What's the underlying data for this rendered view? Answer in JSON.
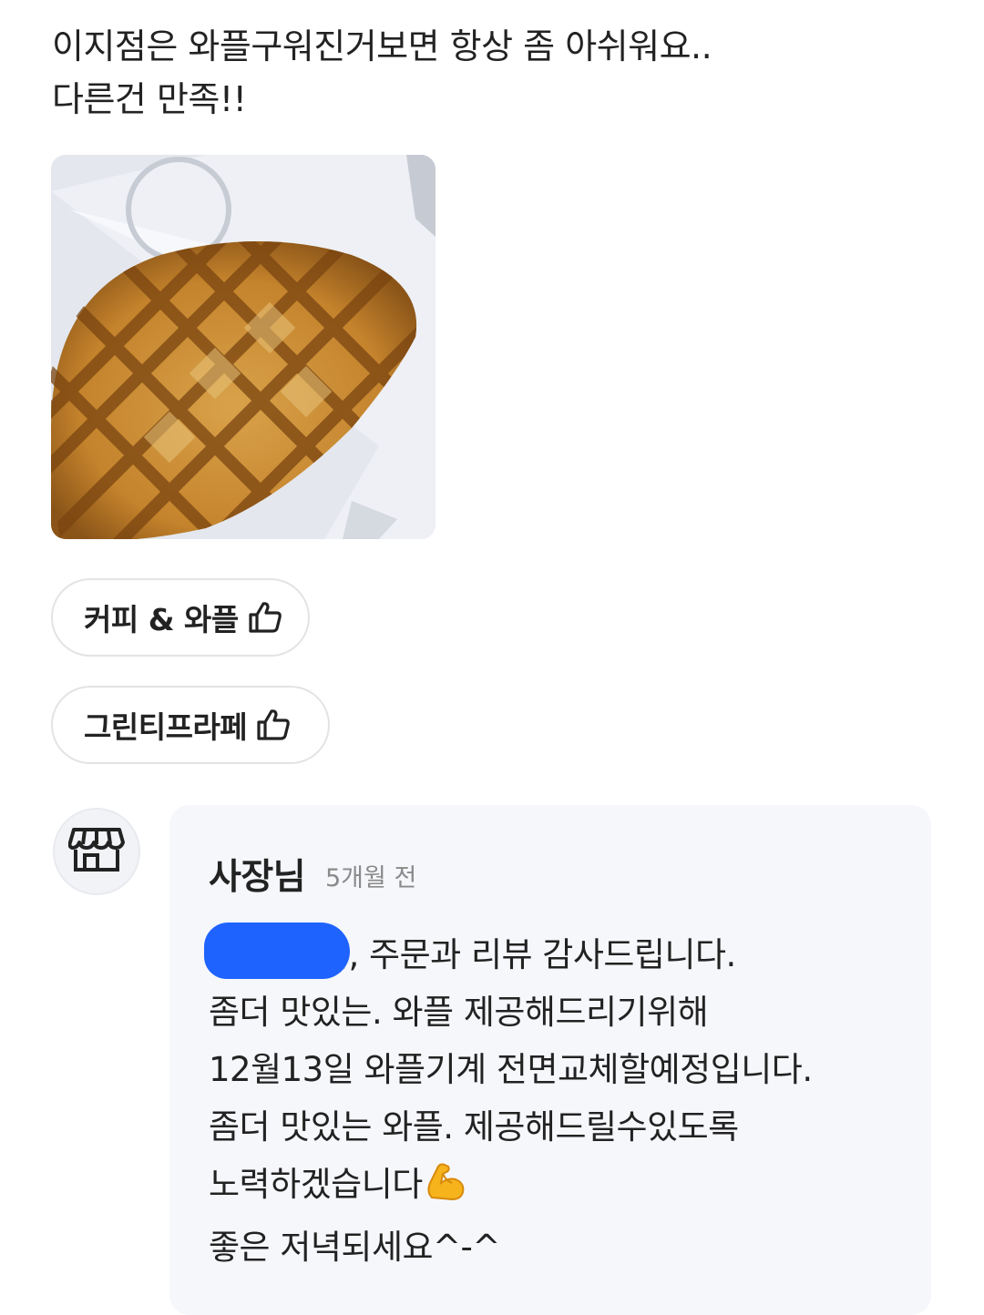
{
  "review": {
    "lines": [
      "이지점은 와플구워진거보면 항상 좀 아쉬워요..",
      "다른건 만족!!"
    ],
    "photo_icon": "waffle-photo"
  },
  "tags": [
    {
      "label": "커피 & 와플",
      "icon": "thumbs-up-icon"
    },
    {
      "label": "그린티프라페",
      "icon": "thumbs-up-icon"
    }
  ],
  "owner_reply": {
    "avatar_icon": "storefront-icon",
    "name": "사장님",
    "time": "5개월 전",
    "lines": [
      "님, 주문과 리뷰 감사드립니다.",
      "좀더 맛있는. 와플 제공해드리기위해",
      "12월13일 와플기계 전면교체할예정입니다.",
      "좀더 맛있는 와플. 제공해드릴수있도록",
      "노력하겠습니다",
      "좋은 저녁되세요^-^"
    ],
    "emoji": "flexed-biceps"
  },
  "colors": {
    "redaction": "#1f63ff",
    "reply_background": "#f6f7fb"
  }
}
